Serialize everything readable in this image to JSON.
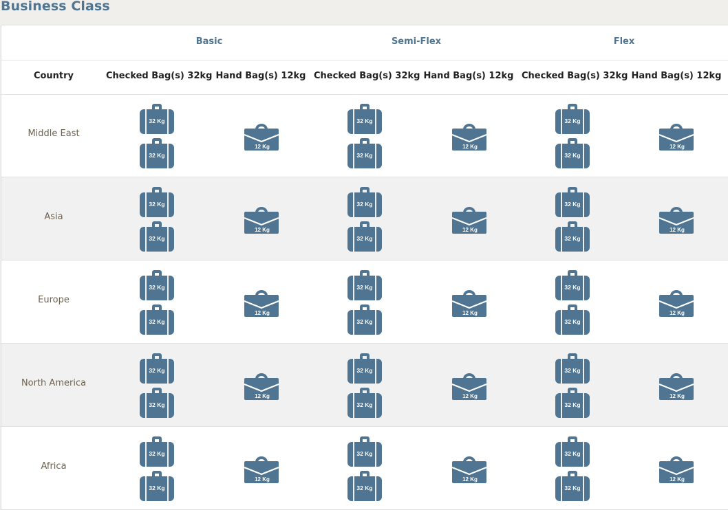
{
  "page": {
    "title": "Business Class"
  },
  "fare_types": [
    "Basic",
    "Semi-Flex",
    "Flex"
  ],
  "columns": {
    "country": "Country",
    "checked": "Checked Bag(s) 32kg",
    "hand": "Hand Bag(s) 12kg"
  },
  "icons": {
    "checked_label": "32 Kg",
    "hand_label": "12 Kg",
    "checked_icon_name": "suitcase-icon",
    "hand_icon_name": "briefcase-icon",
    "icon_color": "#4f7592"
  },
  "rows": [
    {
      "country": "Middle East",
      "checked_bags": [
        2,
        2,
        2
      ],
      "hand_bags": [
        1,
        1,
        1
      ]
    },
    {
      "country": "Asia",
      "checked_bags": [
        2,
        2,
        2
      ],
      "hand_bags": [
        1,
        1,
        1
      ]
    },
    {
      "country": "Europe",
      "checked_bags": [
        2,
        2,
        2
      ],
      "hand_bags": [
        1,
        1,
        1
      ]
    },
    {
      "country": "North America",
      "checked_bags": [
        2,
        2,
        2
      ],
      "hand_bags": [
        1,
        1,
        1
      ]
    },
    {
      "country": "Africa",
      "checked_bags": [
        2,
        2,
        2
      ],
      "hand_bags": [
        1,
        1,
        1
      ]
    }
  ],
  "colors": {
    "accent": "#4f7592",
    "country_text": "#6d6250",
    "alt_row": "#f1f1f1"
  }
}
